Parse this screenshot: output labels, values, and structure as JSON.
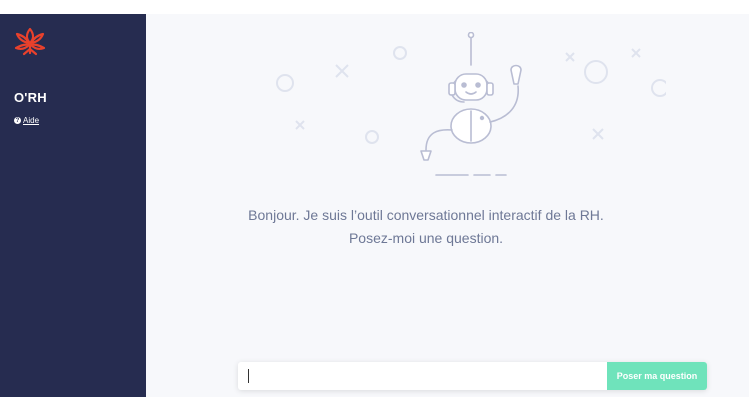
{
  "sidebar": {
    "app_title": "O'RH",
    "help_label": "Aide",
    "help_icon": "question-circle-icon",
    "logo": "lotus-logo"
  },
  "colors": {
    "sidebar_bg": "#262c50",
    "main_bg": "#f7f8fb",
    "accent_green": "#6fe3bb",
    "logo_red": "#e8412c",
    "text_muted": "#6e7896"
  },
  "main": {
    "greeting": "Bonjour. Je suis l’outil conversationnel interactif de la RH. Posez-moi une question.",
    "illustration": "robot-waving-illustration"
  },
  "input": {
    "placeholder": "",
    "value": "",
    "send_label": "Poser ma question"
  }
}
